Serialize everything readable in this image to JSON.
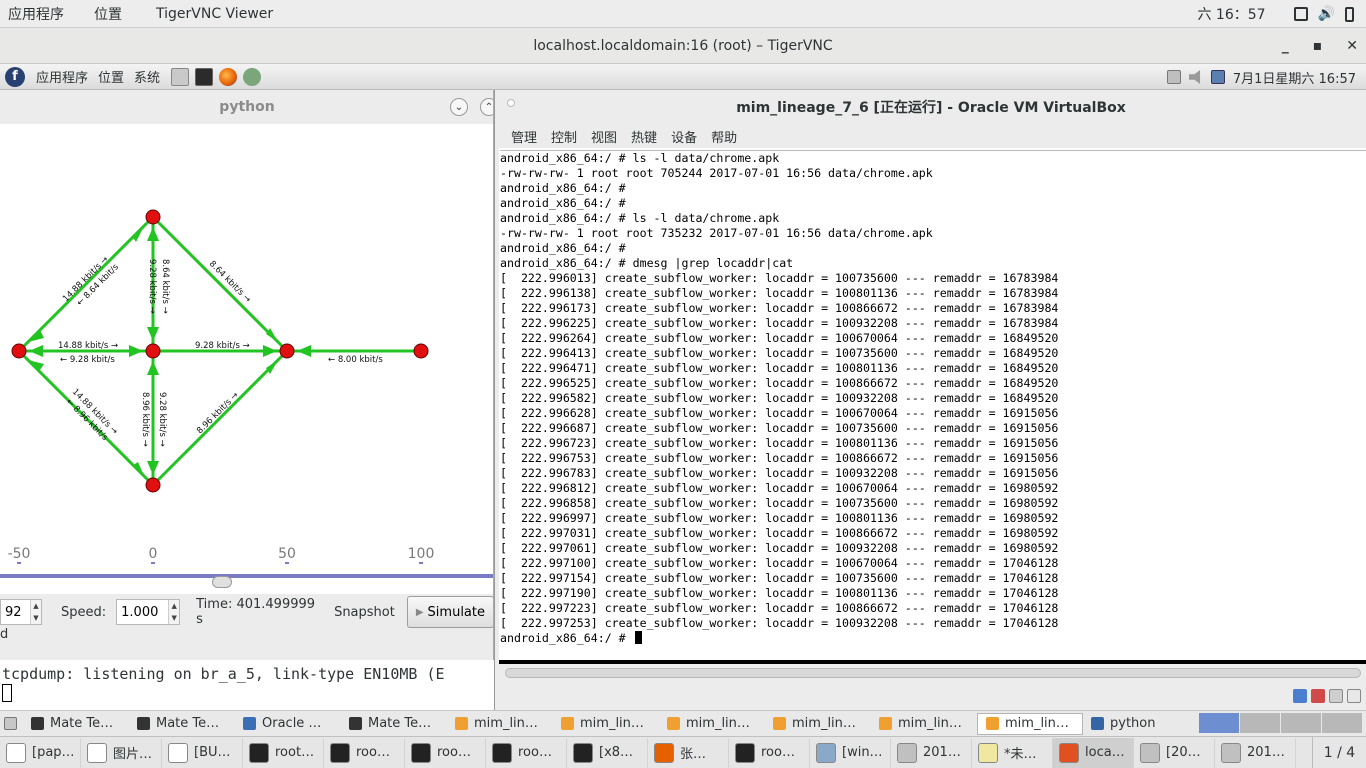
{
  "topbar": {
    "apps_menu": "应用程序",
    "places_menu": "位置",
    "active_app": "TigerVNC Viewer",
    "clock": "六 16：57"
  },
  "vnc_window": {
    "title": "localhost.localdomain:16 (root) – TigerVNC",
    "minimize": "_",
    "maximize": "▪",
    "close": "✕"
  },
  "remote_panel": {
    "apps_menu": "应用程序",
    "places_menu": "位置",
    "system_menu": "系统",
    "datetime": "7月1日星期六 16:57"
  },
  "python_window": {
    "title": "python",
    "axis_ticks": [
      "-50",
      "0",
      "50",
      "100"
    ],
    "edge_labels": {
      "n1_top_down": "14.88 kbit/s →",
      "n1_top_up": "← 8.64 kbit/s",
      "top_center_down": "8.64 kbit/s →",
      "top_center_up": "9.28 kbit/s →",
      "top_right": "8.64 kbit/s →",
      "left_center_fwd": "14.88 kbit/s →",
      "left_center_back": "← 9.28 kbit/s",
      "center_right": "9.28 kbit/s →",
      "right_far": "← 8.00 kbit/s",
      "bl_a": "14.88 kbit/s →",
      "bl_b": "← 8.96 kbit/s",
      "cb_a": "9.28 kbit/s →",
      "cb_b": "8.96 kbit/s →",
      "br": "8.96 kbit/s →"
    },
    "controls": {
      "partial_value": "92",
      "speed_label": "Speed:",
      "speed_value": "1.000",
      "time_label": "Time: 401.499999 s",
      "snapshot": "Snapshot",
      "simulate": "Simulate"
    },
    "bottom_partial": "d"
  },
  "tcpdump": {
    "line": "tcpdump: listening on br_a_5, link-type EN10MB (E"
  },
  "vbox": {
    "title": "mim_lineage_7_6 [正在运行] - Oracle VM VirtualBox",
    "menu": [
      "管理",
      "控制",
      "视图",
      "热键",
      "设备",
      "帮助"
    ],
    "console_lines": [
      "android_x86_64:/ # ls -l data/chrome.apk",
      "-rw-rw-rw- 1 root root 705244 2017-07-01 16:56 data/chrome.apk",
      "android_x86_64:/ #",
      "android_x86_64:/ #",
      "android_x86_64:/ # ls -l data/chrome.apk",
      "-rw-rw-rw- 1 root root 735232 2017-07-01 16:56 data/chrome.apk",
      "android_x86_64:/ #",
      "android_x86_64:/ # dmesg |grep locaddr|cat",
      "[  222.996013] create_subflow_worker: locaddr = 100735600 --- remaddr = 16783984",
      "[  222.996138] create_subflow_worker: locaddr = 100801136 --- remaddr = 16783984",
      "[  222.996173] create_subflow_worker: locaddr = 100866672 --- remaddr = 16783984",
      "[  222.996225] create_subflow_worker: locaddr = 100932208 --- remaddr = 16783984",
      "[  222.996264] create_subflow_worker: locaddr = 100670064 --- remaddr = 16849520",
      "[  222.996413] create_subflow_worker: locaddr = 100735600 --- remaddr = 16849520",
      "[  222.996471] create_subflow_worker: locaddr = 100801136 --- remaddr = 16849520",
      "[  222.996525] create_subflow_worker: locaddr = 100866672 --- remaddr = 16849520",
      "[  222.996582] create_subflow_worker: locaddr = 100932208 --- remaddr = 16849520",
      "[  222.996628] create_subflow_worker: locaddr = 100670064 --- remaddr = 16915056",
      "[  222.996687] create_subflow_worker: locaddr = 100735600 --- remaddr = 16915056",
      "[  222.996723] create_subflow_worker: locaddr = 100801136 --- remaddr = 16915056",
      "[  222.996753] create_subflow_worker: locaddr = 100866672 --- remaddr = 16915056",
      "[  222.996783] create_subflow_worker: locaddr = 100932208 --- remaddr = 16915056",
      "[  222.996812] create_subflow_worker: locaddr = 100670064 --- remaddr = 16980592",
      "[  222.996858] create_subflow_worker: locaddr = 100735600 --- remaddr = 16980592",
      "[  222.996997] create_subflow_worker: locaddr = 100801136 --- remaddr = 16980592",
      "[  222.997031] create_subflow_worker: locaddr = 100866672 --- remaddr = 16980592",
      "[  222.997061] create_subflow_worker: locaddr = 100932208 --- remaddr = 16980592",
      "[  222.997100] create_subflow_worker: locaddr = 100670064 --- remaddr = 17046128",
      "[  222.997154] create_subflow_worker: locaddr = 100735600 --- remaddr = 17046128",
      "[  222.997190] create_subflow_worker: locaddr = 100801136 --- remaddr = 17046128",
      "[  222.997223] create_subflow_worker: locaddr = 100866672 --- remaddr = 17046128",
      "[  222.997253] create_subflow_worker: locaddr = 100932208 --- remaddr = 17046128"
    ],
    "prompt": "android_x86_64:/ #"
  },
  "taskbar_top": {
    "items": [
      {
        "label": "Mate Te…",
        "icon": "terminal-icon",
        "color": "#333333"
      },
      {
        "label": "Mate Te…",
        "icon": "terminal-icon",
        "color": "#333333"
      },
      {
        "label": "Oracle …",
        "icon": "virtualbox-icon",
        "color": "#3a6fb5"
      },
      {
        "label": "Mate Te…",
        "icon": "terminal-icon",
        "color": "#333333"
      },
      {
        "label": "mim_lin…",
        "icon": "vm-icon",
        "color": "#f0a030"
      },
      {
        "label": "mim_lin…",
        "icon": "vm-icon",
        "color": "#f0a030"
      },
      {
        "label": "mim_lin…",
        "icon": "vm-icon",
        "color": "#f0a030"
      },
      {
        "label": "mim_lin…",
        "icon": "vm-icon",
        "color": "#f0a030"
      },
      {
        "label": "mim_lin…",
        "icon": "vm-icon",
        "color": "#f0a030"
      },
      {
        "label": "mim_lin…",
        "icon": "vm-icon",
        "color": "#f0a030"
      },
      {
        "label": "python",
        "icon": "window-icon",
        "color": "#3465a4"
      }
    ]
  },
  "taskbar_bottom": {
    "items": [
      {
        "label": "[pap…",
        "icon": "document-icon",
        "color": "#ffffff"
      },
      {
        "label": "图片…",
        "icon": "document-icon",
        "color": "#ffffff"
      },
      {
        "label": "[BU…",
        "icon": "document-icon",
        "color": "#ffffff"
      },
      {
        "label": "root…",
        "icon": "terminal-icon",
        "color": "#222222"
      },
      {
        "label": "roo…",
        "icon": "terminal-icon",
        "color": "#222222"
      },
      {
        "label": "roo…",
        "icon": "terminal-icon",
        "color": "#222222"
      },
      {
        "label": "roo…",
        "icon": "terminal-icon",
        "color": "#222222"
      },
      {
        "label": "[x8…",
        "icon": "terminal-icon",
        "color": "#222222"
      },
      {
        "label": "张…",
        "icon": "firefox-icon",
        "color": "#e66000"
      },
      {
        "label": "roo…",
        "icon": "terminal-icon",
        "color": "#222222"
      },
      {
        "label": "[win…",
        "icon": "package-icon",
        "color": "#8aa8c8"
      },
      {
        "label": "201…",
        "icon": "image-viewer-icon",
        "color": "#c0c0c0"
      },
      {
        "label": "*未…",
        "icon": "text-editor-icon",
        "color": "#f0e8a0"
      },
      {
        "label": "loca…",
        "icon": "vnc-icon",
        "color": "#e05020"
      },
      {
        "label": "[20…",
        "icon": "image-viewer-icon",
        "color": "#c0c0c0"
      },
      {
        "label": "201…",
        "icon": "image-viewer-icon",
        "color": "#c0c0c0"
      }
    ],
    "pager": "1 / 4"
  }
}
